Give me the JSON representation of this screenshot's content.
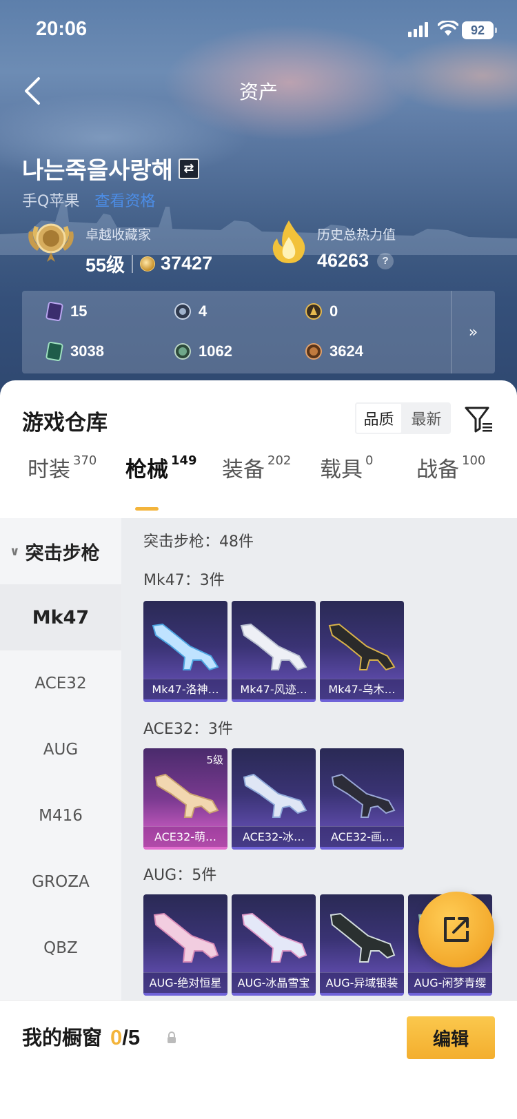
{
  "status_bar": {
    "time": "20:06",
    "battery": "92"
  },
  "nav": {
    "title": "资产"
  },
  "profile": {
    "username": "나는죽을사랑해",
    "platform": "手Q苹果",
    "view_link": "查看资格",
    "collector_label": "卓越收藏家",
    "level": "55级",
    "points": "37427",
    "heat_label": "历史总热力值",
    "heat_value": "46263"
  },
  "currencies": [
    {
      "icon": "purple-card-icon",
      "value": "15"
    },
    {
      "icon": "silver-coin-icon",
      "value": "4"
    },
    {
      "icon": "gold-coin-icon",
      "value": "0"
    },
    {
      "icon": "green-card-icon",
      "value": "3038"
    },
    {
      "icon": "green-gem-icon",
      "value": "1062"
    },
    {
      "icon": "bronze-coin-icon",
      "value": "3624"
    }
  ],
  "warehouse": {
    "title": "游戏仓库",
    "sort_quality": "品质",
    "sort_newest": "最新"
  },
  "tabs": [
    {
      "label": "时装",
      "count": "370"
    },
    {
      "label": "枪械",
      "count": "149"
    },
    {
      "label": "装备",
      "count": "202"
    },
    {
      "label": "载具",
      "count": "0"
    },
    {
      "label": "战备",
      "count": "100"
    }
  ],
  "sidebar": {
    "group": "突击步枪",
    "items": [
      "Mk47",
      "ACE32",
      "AUG",
      "M416",
      "GROZA",
      "QBZ"
    ]
  },
  "content": {
    "summary": "突击步枪：48件",
    "sections": [
      {
        "heading": "Mk47：3件",
        "items": [
          {
            "label": "Mk47-洛神…"
          },
          {
            "label": "Mk47-风迹…"
          },
          {
            "label": "Mk47-乌木…"
          }
        ]
      },
      {
        "heading": "ACE32：3件",
        "items": [
          {
            "label": "ACE32-萌…",
            "level": "5级"
          },
          {
            "label": "ACE32-冰…"
          },
          {
            "label": "ACE32-画…"
          }
        ]
      },
      {
        "heading": "AUG：5件",
        "items": [
          {
            "label": "AUG-绝对恒星"
          },
          {
            "label": "AUG-冰晶雪宝"
          },
          {
            "label": "AUG-异域银装"
          },
          {
            "label": "AUG-闲梦青缨"
          }
        ]
      }
    ]
  },
  "showcase": {
    "title": "我的橱窗",
    "count": "0",
    "total": "/5",
    "edit": "编辑"
  },
  "colors": {
    "accent": "#f3b43b",
    "link": "#4c8de6",
    "card_purple": "#3a3374",
    "card_pink": "#c75ac0"
  }
}
